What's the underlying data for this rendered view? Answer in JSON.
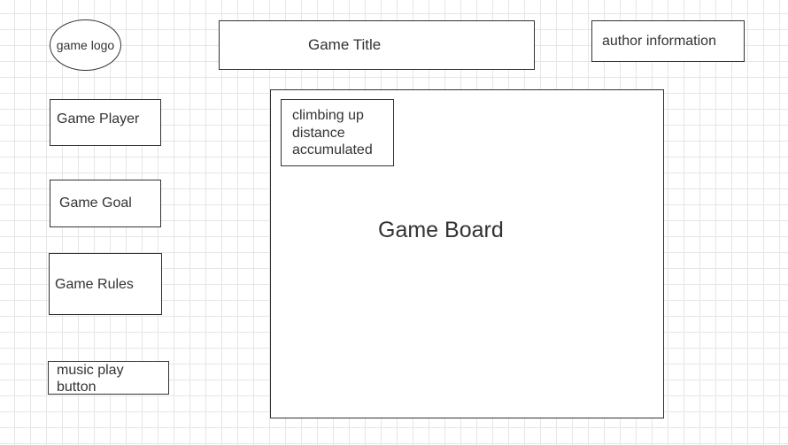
{
  "logo": {
    "label": "game logo"
  },
  "title": {
    "label": "Game Title"
  },
  "author": {
    "label": "author information"
  },
  "sidebar": {
    "player": "Game Player",
    "goal": "Game Goal",
    "rules": "Game Rules",
    "music": "music play button"
  },
  "board": {
    "label": "Game Board",
    "distance_counter": "climbing up distance accumulated"
  }
}
